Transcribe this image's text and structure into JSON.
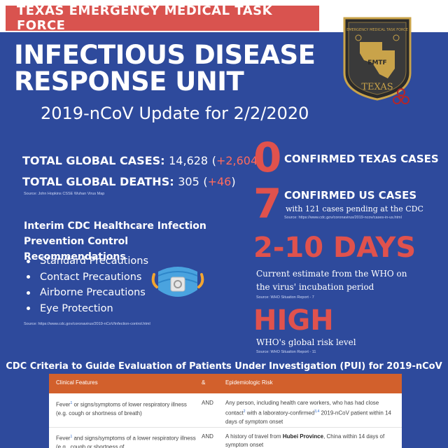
{
  "header": {
    "org_name": "TEXAS EMERGENCY MEDICAL TASK FORCE"
  },
  "title": {
    "line1": "INFECTIOUS DISEASE",
    "line2": "RESPONSE UNIT",
    "subtitle": "2019-nCoV Update for 2/2/2020"
  },
  "badge": {
    "arc_text": "EMERGENCY MEDICAL TASK FORCE",
    "initials": "EMTF",
    "state": "TEXAS"
  },
  "global": {
    "cases_label": "TOTAL GLOBAL CASES:",
    "cases_value": "14,628",
    "cases_delta": "+2,604",
    "deaths_label": "TOTAL GLOBAL DEATHS:",
    "deaths_value": "305",
    "deaths_delta": "+46",
    "source": "Source: John Hopkins CSSE Wuhan Virus Map"
  },
  "texas": {
    "number": "0",
    "label": "CONFIRMED TEXAS CASES"
  },
  "us": {
    "number": "7",
    "label": "CONFIRMED US CASES",
    "sub": "with 121 cases pending at the CDC",
    "source": "Source: https://www.cdc.gov/coronavirus/2019-ncov/cases-in-us.html"
  },
  "incubation": {
    "value": "2-10 DAYS",
    "line1": "Current estimate from the WHO on",
    "line2": "the virus' incubation period",
    "source": "Source: WHO Situation Report - 7"
  },
  "risk": {
    "value": "HIGH",
    "label": "WHO's global risk level",
    "source": "Source: WHO Situation Report - 11"
  },
  "recommendations": {
    "title_line1": "Interim CDC Healthcare Infection",
    "title_line2": "Prevention Control Recommendations",
    "items": [
      "Standard Precautions",
      "Contact Precautions",
      "Airborne Precautions",
      "Eye Protection"
    ],
    "source": "Source: https://www.cdc.gov/coronavirus/2019-nCoV/infection-control.html"
  },
  "pui": {
    "title": "CDC Criteria to Guide Evaluation of Patients Under Investigation (PUI) for 2019-nCoV",
    "headers": [
      "Clinical Features",
      "&",
      "Epidemiologic Risk"
    ],
    "rows": [
      {
        "clinical": [
          "Fever",
          "1",
          " or signs/symptoms of lower respiratory illness (e.g. cough or shortness of breath)"
        ],
        "connector": "AND",
        "risk": [
          "Any person, including health care workers, who has had close contact",
          "2",
          " with a laboratory-confirmed",
          "3,4",
          " 2019-nCoV patient within 14 days of symptom onset"
        ]
      },
      {
        "clinical": [
          "Fever",
          "1",
          " and signs/symptoms of a lower respiratory illness (e.g., cough or shortness of"
        ],
        "connector": "AND",
        "risk": [
          "A history of travel from ",
          "Hubei Province",
          ", China within 14 days of symptom onset"
        ]
      }
    ]
  },
  "colors": {
    "background": "#2e4a9c",
    "accent_red": "#e0524d",
    "table_header": "#d2602c"
  }
}
